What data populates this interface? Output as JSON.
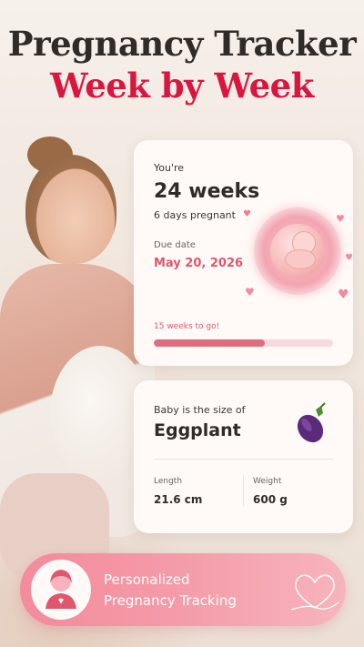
{
  "header": {
    "title_line1": "Pregnancy Tracker",
    "title_line2": "Week by Week"
  },
  "progress_card": {
    "intro": "You're",
    "weeks": "24 weeks",
    "days": "6 days pregnant",
    "due_label": "Due date",
    "due_date": "May 20, 2026",
    "remaining": "15 weeks to go!",
    "progress_fraction": 0.62
  },
  "size_card": {
    "label": "Baby is the size of",
    "value": "Eggplant",
    "length_label": "Length",
    "length_value": "21.6 cm",
    "weight_label": "Weight",
    "weight_value": "600 g"
  },
  "banner": {
    "line1": "Personalized",
    "line2": "Pregnancy Tracking"
  },
  "icons": {
    "heart": "heart-icon",
    "eggplant": "eggplant-icon",
    "mother": "mother-icon",
    "fetus": "fetus-illustration"
  },
  "colors": {
    "accent": "#d9163f",
    "pink": "#e0566c",
    "banner": "#f38b9c",
    "text": "#2f2b29"
  }
}
